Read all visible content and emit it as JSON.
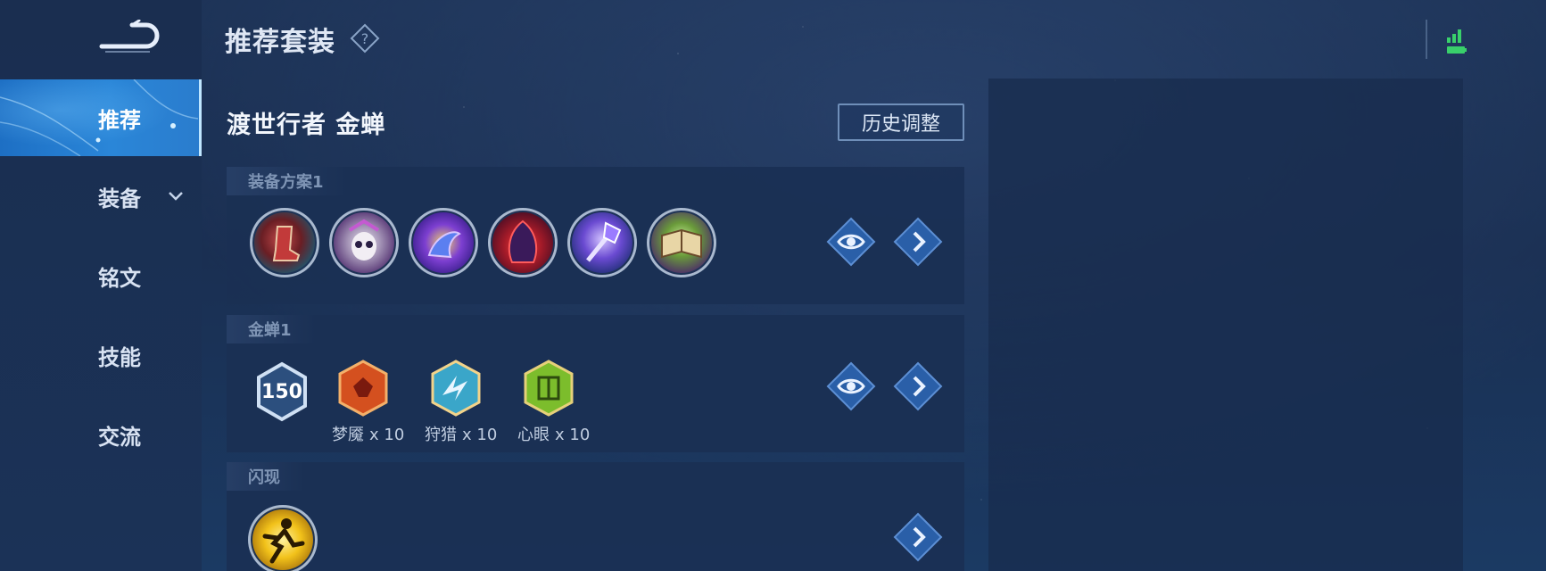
{
  "header": {
    "title": "推荐套装"
  },
  "sidebar": {
    "items": [
      {
        "label": "推荐"
      },
      {
        "label": "装备"
      },
      {
        "label": "铭文"
      },
      {
        "label": "技能"
      },
      {
        "label": "交流"
      }
    ],
    "active_index": 0
  },
  "hero": {
    "name": "渡世行者 金蝉",
    "history_button": "历史调整"
  },
  "equipment_card": {
    "tab_label": "装备方案1",
    "items": [
      {
        "icon": "boots-item-icon"
      },
      {
        "icon": "skull-mask-item-icon"
      },
      {
        "icon": "purple-dragon-item-icon"
      },
      {
        "icon": "dark-cloak-item-icon"
      },
      {
        "icon": "scepter-item-icon"
      },
      {
        "icon": "tome-item-icon"
      }
    ]
  },
  "rune_card": {
    "tab_label": "金蝉1",
    "level": "150",
    "runes": [
      {
        "name": "梦魇",
        "count": "x 10",
        "color": "#d4501f"
      },
      {
        "name": "狩猎",
        "count": "x 10",
        "color": "#3aa6c9"
      },
      {
        "name": "心眼",
        "count": "x 10",
        "color": "#7cbd2c"
      }
    ]
  },
  "skill_card": {
    "tab_label": "闪现",
    "skill_icon": "flash-skill-icon"
  },
  "colors": {
    "accent_blue": "#2a86d8",
    "background": "#1a2f52",
    "panel": "#1a3054"
  }
}
